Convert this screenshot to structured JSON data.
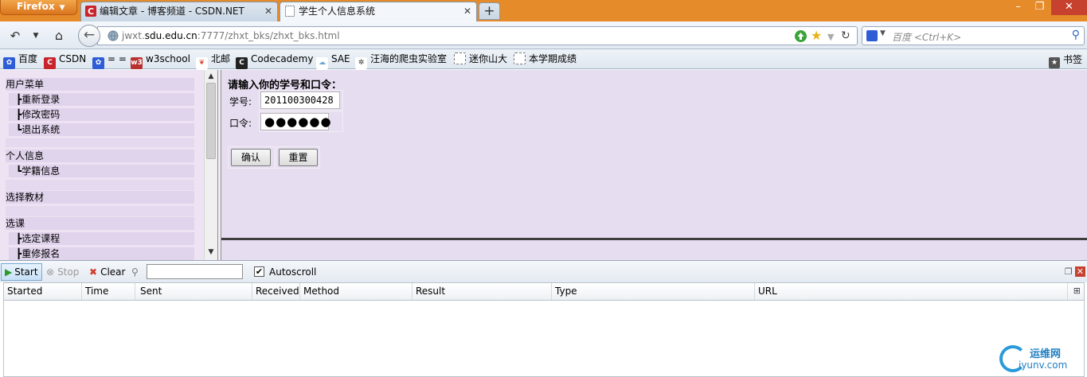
{
  "browser": {
    "menu_label": "Firefox",
    "tabs": [
      {
        "label": "编辑文章 - 博客频道 - CSDN.NET",
        "favicon": "csdn-icon"
      },
      {
        "label": "学生个人信息系统",
        "favicon": "blank-page-icon"
      }
    ],
    "new_tab": "+",
    "window_controls": {
      "minimize": "–",
      "maximize": "❐",
      "close": "✕"
    }
  },
  "nav": {
    "url_host": "jwxt.",
    "url_domain": "sdu.edu.cn",
    "url_path": ":7777/zhxt_bks/zhxt_bks.html",
    "search_placeholder": "百度 <Ctrl+K>"
  },
  "bookmarks": {
    "items": [
      {
        "label": "百度",
        "icon": "baidu-icon",
        "color": "#2f5dd6"
      },
      {
        "label": "CSDN",
        "icon": "csdn-icon",
        "color": "#c8242b"
      },
      {
        "label": "= =",
        "icon": "baidu-icon",
        "color": "#2f5dd6"
      },
      {
        "label": "w3school",
        "icon": "w3school-icon",
        "color": "#b8312f"
      },
      {
        "label": "北邮",
        "icon": "byr-icon",
        "color": "#d9463b"
      },
      {
        "label": "Codecademy",
        "icon": "codecademy-icon",
        "color": "#222222"
      },
      {
        "label": "SAE",
        "icon": "cloud-icon",
        "color": "#6fa8d8"
      },
      {
        "label": "汪海的爬虫实验室",
        "icon": "spider-icon",
        "color": "#333333"
      },
      {
        "label": "迷你山大",
        "icon": "blank-page-icon",
        "color": "#ffffff"
      },
      {
        "label": "本学期成绩",
        "icon": "blank-page-icon",
        "color": "#ffffff"
      }
    ],
    "right_label": "书签"
  },
  "left_menu": {
    "g1_title": "用户菜单",
    "g1_items": [
      "┣重新登录",
      "┣修改密码",
      "┗退出系统"
    ],
    "g2_title": "个人信息",
    "g2_items": [
      "┗学籍信息"
    ],
    "g3_title": "选择教材",
    "g4_title": "选课",
    "g4_items": [
      "┣选定课程",
      "┣重修报名"
    ]
  },
  "login": {
    "title": "请输入你的学号和口令：",
    "id_label": "学号:",
    "id_value": "201100300428",
    "pwd_label": "口令:",
    "pwd_value": "●●●●●●",
    "ok_label": "确认",
    "reset_label": "重置"
  },
  "httpfox": {
    "start": "Start",
    "stop": "Stop",
    "clear": "Clear",
    "autoscroll": "Autoscroll",
    "columns": [
      "Started",
      "Time",
      "Sent",
      "Received",
      "Method",
      "Result",
      "Type",
      "URL"
    ]
  },
  "watermark": {
    "cn": "运维网",
    "en": "iyunv.com"
  },
  "colors": {
    "left_frame_bg": "#ede3f3",
    "main_frame_bg": "#e6ddf0",
    "titlebar": "#e58b2a"
  }
}
